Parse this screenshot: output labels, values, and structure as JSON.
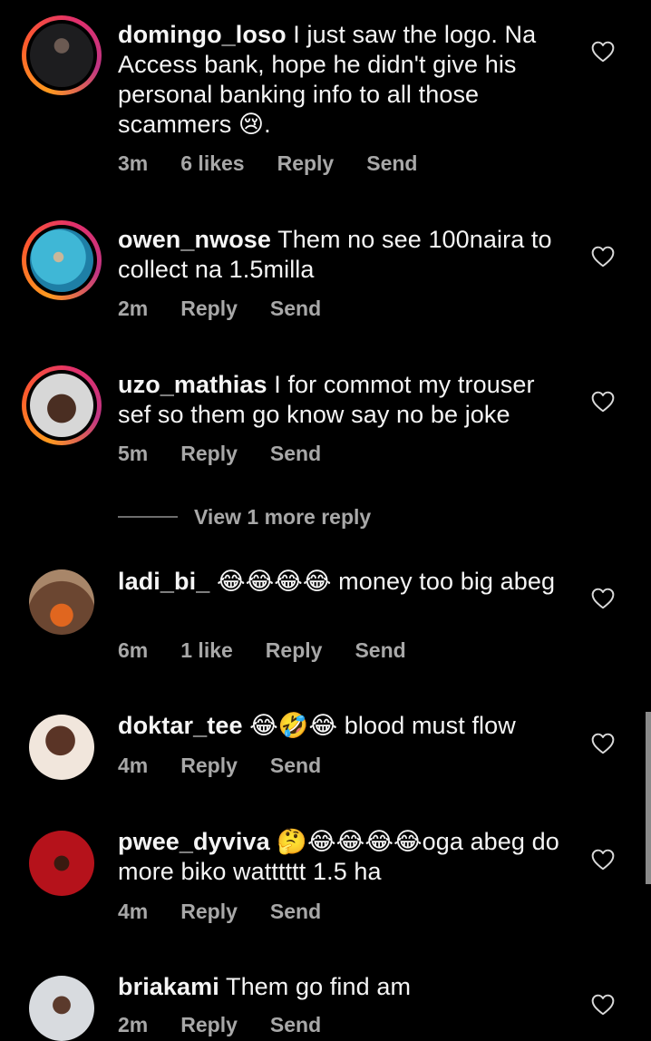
{
  "comments": [
    {
      "username": "domingo_loso",
      "text": " I just saw the logo. Na Access bank, hope he didn't give his personal banking info to all those scammers 😢.",
      "time": "3m",
      "likes": "6 likes",
      "reply": "Reply",
      "send": "Send"
    },
    {
      "username": "owen_nwose",
      "text": " Them no see 100naira to collect na 1.5milla",
      "time": "2m",
      "reply": "Reply",
      "send": "Send"
    },
    {
      "username": "uzo_mathias",
      "text": " I for commot my trouser sef so them go know say no be joke",
      "time": "5m",
      "reply": "Reply",
      "send": "Send"
    },
    {
      "username": "ladi_bi_",
      "text": " 😂😂😂😂 money too big abeg",
      "time": "6m",
      "likes": "1 like",
      "reply": "Reply",
      "send": "Send"
    },
    {
      "username": "doktar_tee",
      "text": " 😂🤣😂 blood must flow",
      "time": "4m",
      "reply": "Reply",
      "send": "Send"
    },
    {
      "username": "pwee_dyviva",
      "text": " 🤔😂😂😂😂oga abeg do more biko watttttt 1.5 ha",
      "time": "4m",
      "reply": "Reply",
      "send": "Send"
    },
    {
      "username": "briakami",
      "text": " Them go find am",
      "time": "2m",
      "reply": "Reply",
      "send": "Send"
    }
  ],
  "view_more": "View 1 more reply",
  "icons": {
    "like": "heart-outline-icon"
  },
  "colors": {
    "background": "#000000",
    "text": "#f5f5f5",
    "meta": "#a8a8a8"
  }
}
